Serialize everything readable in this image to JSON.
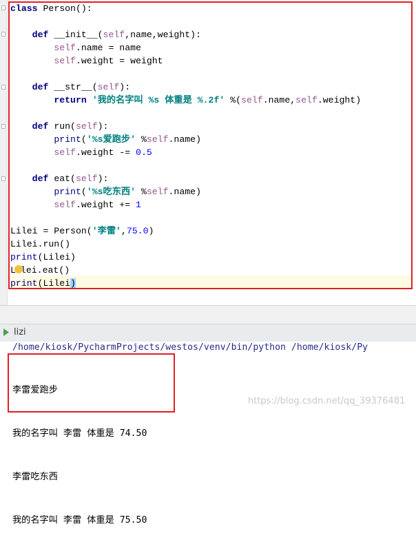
{
  "editor": {
    "lines": [
      [
        {
          "t": "class",
          "c": "kw"
        },
        {
          "t": " Person():",
          "c": "fn"
        }
      ],
      [],
      [
        {
          "t": "    "
        },
        {
          "t": "def",
          "c": "kw"
        },
        {
          "t": " __init__(",
          "c": "fn"
        },
        {
          "t": "self",
          "c": "slf"
        },
        {
          "t": ",name,weight):",
          "c": "fn"
        }
      ],
      [
        {
          "t": "        "
        },
        {
          "t": "self",
          "c": "slf"
        },
        {
          "t": ".name = name"
        }
      ],
      [
        {
          "t": "        "
        },
        {
          "t": "self",
          "c": "slf"
        },
        {
          "t": ".weight = weight"
        }
      ],
      [],
      [
        {
          "t": "    "
        },
        {
          "t": "def",
          "c": "kw"
        },
        {
          "t": " __str__(",
          "c": "fn"
        },
        {
          "t": "self",
          "c": "slf"
        },
        {
          "t": "):"
        }
      ],
      [
        {
          "t": "        "
        },
        {
          "t": "return",
          "c": "kw"
        },
        {
          "t": " "
        },
        {
          "t": "'我的名字叫 %s 体重是 %.2f'",
          "c": "str"
        },
        {
          "t": " %("
        },
        {
          "t": "self",
          "c": "slf"
        },
        {
          "t": ".name,"
        },
        {
          "t": "self",
          "c": "slf"
        },
        {
          "t": ".weight)"
        }
      ],
      [],
      [
        {
          "t": "    "
        },
        {
          "t": "def",
          "c": "kw"
        },
        {
          "t": " run("
        },
        {
          "t": "self",
          "c": "slf"
        },
        {
          "t": "):"
        }
      ],
      [
        {
          "t": "        "
        },
        {
          "t": "print",
          "c": "bi"
        },
        {
          "t": "("
        },
        {
          "t": "'%s爱跑步'",
          "c": "str"
        },
        {
          "t": " %"
        },
        {
          "t": "self",
          "c": "slf"
        },
        {
          "t": ".name)"
        }
      ],
      [
        {
          "t": "        "
        },
        {
          "t": "self",
          "c": "slf"
        },
        {
          "t": ".weight -= "
        },
        {
          "t": "0.5",
          "c": "num"
        }
      ],
      [],
      [
        {
          "t": "    "
        },
        {
          "t": "def",
          "c": "kw"
        },
        {
          "t": " eat("
        },
        {
          "t": "self",
          "c": "slf"
        },
        {
          "t": "):"
        }
      ],
      [
        {
          "t": "        "
        },
        {
          "t": "print",
          "c": "bi"
        },
        {
          "t": "("
        },
        {
          "t": "'%s吃东西'",
          "c": "str"
        },
        {
          "t": " %"
        },
        {
          "t": "self",
          "c": "slf"
        },
        {
          "t": ".name)"
        }
      ],
      [
        {
          "t": "        "
        },
        {
          "t": "self",
          "c": "slf"
        },
        {
          "t": ".weight += "
        },
        {
          "t": "1",
          "c": "num"
        }
      ],
      [],
      [
        {
          "t": "Lilei = Person("
        },
        {
          "t": "'李雷'",
          "c": "str"
        },
        {
          "t": ","
        },
        {
          "t": "75.0",
          "c": "num"
        },
        {
          "t": ")"
        }
      ],
      [
        {
          "t": "Lilei.run()"
        }
      ],
      [
        {
          "t": "print",
          "c": "bi"
        },
        {
          "t": "(Lilei)"
        }
      ],
      [
        {
          "t": "L"
        },
        {
          "t": "",
          "c": "bulb"
        },
        {
          "t": "lei.eat()"
        }
      ],
      [
        {
          "t": "print",
          "c": "bi"
        },
        {
          "t": "(Lilei"
        },
        {
          "t": ")",
          "c": "cur"
        }
      ]
    ]
  },
  "run_panel": {
    "tab_name": "lizi",
    "command": "/home/kiosk/PycharmProjects/westos/venv/bin/python /home/kiosk/Py",
    "output": [
      "李雷爱跑步",
      "我的名字叫 李雷 体重是 74.50",
      "李雷吃东西",
      "我的名字叫 李雷 体重是 75.50"
    ]
  },
  "watermark": "https://blog.csdn.net/qq_39376481",
  "colors": {
    "keyword": "#000080",
    "self": "#94558d",
    "string": "#008080",
    "number": "#0000ff",
    "highlight_box": "#e01f26"
  }
}
